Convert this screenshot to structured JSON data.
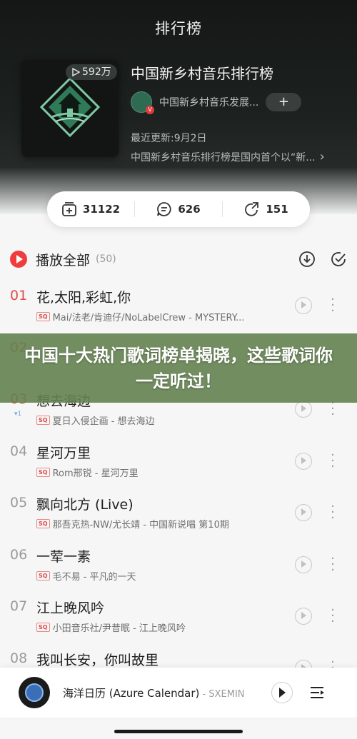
{
  "header": {
    "title": "排行榜"
  },
  "playlist": {
    "play_count": "592万",
    "name": "中国新乡村音乐排行榜",
    "creator": "中国新乡村音乐发展...",
    "creator_badge": "V",
    "follow_label": "+",
    "update": "最近更新:9月2日",
    "description": "中国新乡村音乐排行榜是国内首个以“新...",
    "desc_arrow": "›"
  },
  "actions": {
    "collect_count": "31122",
    "comment_count": "626",
    "share_count": "151"
  },
  "play_all": {
    "label": "播放全部",
    "count": "(50)"
  },
  "songs": [
    {
      "rank": "01",
      "change": "",
      "title": "花,太阳,彩虹,你",
      "artist": "Mai/法老/肯迪仔/NoLabelCrew - MYSTERY...",
      "badge": "SQ"
    },
    {
      "rank": "02",
      "change": "",
      "title": "",
      "artist": "",
      "badge": ""
    },
    {
      "rank": "03",
      "change": "▾1",
      "title": "想去海边",
      "artist": "夏日入侵企画 - 想去海边",
      "badge": "SQ"
    },
    {
      "rank": "04",
      "change": "",
      "title": "星河万里",
      "artist": "Rom邢锐 - 星河万里",
      "badge": "SQ"
    },
    {
      "rank": "05",
      "change": "",
      "title": "飘向北方 (Live)",
      "artist": "那吾克热-NW/尤长靖 - 中国新说唱 第10期",
      "badge": "SQ"
    },
    {
      "rank": "06",
      "change": "",
      "title": "一荤一素",
      "artist": "毛不易 - 平凡的一天",
      "badge": "SQ"
    },
    {
      "rank": "07",
      "change": "",
      "title": "江上晚风吟",
      "artist": "小田音乐社/尹昔眠 - 江上晚风吟",
      "badge": "SQ"
    },
    {
      "rank": "08",
      "change": "",
      "title": "我叫长安，你叫故里",
      "artist": "",
      "badge": ""
    }
  ],
  "banner": {
    "text": "中国十大热门歌词榜单揭晓，这些歌词你一定听过！"
  },
  "player": {
    "title": "海洋日历 (Azure Calendar)",
    "subtitle": " - SXEMIN"
  },
  "colors": {
    "accent": "#f03c3c",
    "banner": "#648250",
    "header_dark": "#1a1e1c"
  }
}
